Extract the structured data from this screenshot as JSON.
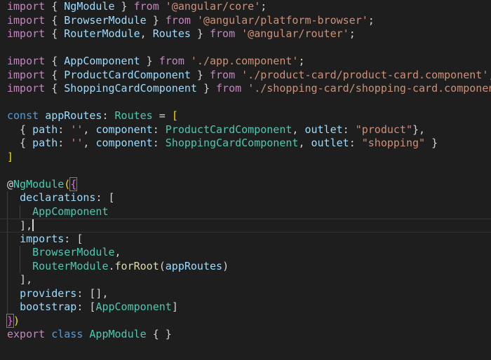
{
  "editor": {
    "lines": [
      [
        {
          "t": "import",
          "c": "keyword"
        },
        {
          "t": " { ",
          "c": "punct"
        },
        {
          "t": "NgModule",
          "c": "variable"
        },
        {
          "t": " } ",
          "c": "punct"
        },
        {
          "t": "from",
          "c": "keyword"
        },
        {
          "t": " ",
          "c": "punct"
        },
        {
          "t": "'@angular/core'",
          "c": "string"
        },
        {
          "t": ";",
          "c": "punct"
        }
      ],
      [
        {
          "t": "import",
          "c": "keyword"
        },
        {
          "t": " { ",
          "c": "punct"
        },
        {
          "t": "BrowserModule",
          "c": "variable"
        },
        {
          "t": " } ",
          "c": "punct"
        },
        {
          "t": "from",
          "c": "keyword"
        },
        {
          "t": " ",
          "c": "punct"
        },
        {
          "t": "'@angular/platform-browser'",
          "c": "string"
        },
        {
          "t": ";",
          "c": "punct"
        }
      ],
      [
        {
          "t": "import",
          "c": "keyword"
        },
        {
          "t": " { ",
          "c": "punct"
        },
        {
          "t": "RouterModule",
          "c": "variable"
        },
        {
          "t": ", ",
          "c": "punct"
        },
        {
          "t": "Routes",
          "c": "variable"
        },
        {
          "t": " } ",
          "c": "punct"
        },
        {
          "t": "from",
          "c": "keyword"
        },
        {
          "t": " ",
          "c": "punct"
        },
        {
          "t": "'@angular/router'",
          "c": "string"
        },
        {
          "t": ";",
          "c": "punct"
        }
      ],
      [],
      [
        {
          "t": "import",
          "c": "keyword"
        },
        {
          "t": " { ",
          "c": "punct"
        },
        {
          "t": "AppComponent",
          "c": "variable"
        },
        {
          "t": " } ",
          "c": "punct"
        },
        {
          "t": "from",
          "c": "keyword"
        },
        {
          "t": " ",
          "c": "punct"
        },
        {
          "t": "'./app.component'",
          "c": "string"
        },
        {
          "t": ";",
          "c": "punct"
        }
      ],
      [
        {
          "t": "import",
          "c": "keyword"
        },
        {
          "t": " { ",
          "c": "punct"
        },
        {
          "t": "ProductCardComponent",
          "c": "variable"
        },
        {
          "t": " } ",
          "c": "punct"
        },
        {
          "t": "from",
          "c": "keyword"
        },
        {
          "t": " ",
          "c": "punct"
        },
        {
          "t": "'./product-card/product-card.component'",
          "c": "string"
        },
        {
          "t": ";",
          "c": "punct"
        }
      ],
      [
        {
          "t": "import",
          "c": "keyword"
        },
        {
          "t": " { ",
          "c": "punct"
        },
        {
          "t": "ShoppingCardComponent",
          "c": "variable"
        },
        {
          "t": " } ",
          "c": "punct"
        },
        {
          "t": "from",
          "c": "keyword"
        },
        {
          "t": " ",
          "c": "punct"
        },
        {
          "t": "'./shopping-card/shopping-card.component'",
          "c": "string"
        },
        {
          "t": ";",
          "c": "punct"
        }
      ],
      [],
      [
        {
          "t": "const",
          "c": "storage"
        },
        {
          "t": " ",
          "c": "punct"
        },
        {
          "t": "appRoutes",
          "c": "variable"
        },
        {
          "t": ": ",
          "c": "punct"
        },
        {
          "t": "Routes",
          "c": "identifier"
        },
        {
          "t": " = ",
          "c": "punct"
        },
        {
          "t": "[",
          "c": "bracket"
        }
      ],
      [
        {
          "t": "  { ",
          "c": "punct"
        },
        {
          "t": "path",
          "c": "property"
        },
        {
          "t": ": ",
          "c": "punct"
        },
        {
          "t": "''",
          "c": "string"
        },
        {
          "t": ", ",
          "c": "punct"
        },
        {
          "t": "component",
          "c": "property"
        },
        {
          "t": ": ",
          "c": "punct"
        },
        {
          "t": "ProductCardComponent",
          "c": "identifier"
        },
        {
          "t": ", ",
          "c": "punct"
        },
        {
          "t": "outlet",
          "c": "property"
        },
        {
          "t": ": ",
          "c": "punct"
        },
        {
          "t": "\"product\"",
          "c": "string"
        },
        {
          "t": "},",
          "c": "punct"
        }
      ],
      [
        {
          "t": "  { ",
          "c": "punct"
        },
        {
          "t": "path",
          "c": "property"
        },
        {
          "t": ": ",
          "c": "punct"
        },
        {
          "t": "''",
          "c": "string"
        },
        {
          "t": ", ",
          "c": "punct"
        },
        {
          "t": "component",
          "c": "property"
        },
        {
          "t": ": ",
          "c": "punct"
        },
        {
          "t": "ShoppingCardComponent",
          "c": "identifier"
        },
        {
          "t": ", ",
          "c": "punct"
        },
        {
          "t": "outlet",
          "c": "property"
        },
        {
          "t": ": ",
          "c": "punct"
        },
        {
          "t": "\"shopping\"",
          "c": "string"
        },
        {
          "t": " }",
          "c": "punct"
        }
      ],
      [
        {
          "t": "]",
          "c": "bracket"
        }
      ],
      [],
      [
        {
          "t": "@",
          "c": "punct"
        },
        {
          "t": "NgModule",
          "c": "identifier"
        },
        {
          "t": "(",
          "c": "bracket"
        },
        {
          "t": "{",
          "c": "paren",
          "box": true
        }
      ],
      [
        {
          "t": "  ",
          "c": "punct"
        },
        {
          "t": "declarations",
          "c": "property"
        },
        {
          "t": ": ",
          "c": "punct"
        },
        {
          "t": "[",
          "c": "plain"
        }
      ],
      [
        {
          "t": "    ",
          "c": "punct"
        },
        {
          "t": "AppComponent",
          "c": "identifier"
        }
      ],
      [
        {
          "t": "  ],",
          "c": "punct"
        },
        {
          "t": "",
          "c": "punct",
          "cursor": true
        }
      ],
      [
        {
          "t": "  ",
          "c": "punct"
        },
        {
          "t": "imports",
          "c": "property"
        },
        {
          "t": ": ",
          "c": "punct"
        },
        {
          "t": "[",
          "c": "plain"
        }
      ],
      [
        {
          "t": "    ",
          "c": "punct"
        },
        {
          "t": "BrowserModule",
          "c": "identifier"
        },
        {
          "t": ",",
          "c": "punct"
        }
      ],
      [
        {
          "t": "    ",
          "c": "punct"
        },
        {
          "t": "RouterModule",
          "c": "identifier"
        },
        {
          "t": ".",
          "c": "punct"
        },
        {
          "t": "forRoot",
          "c": "function"
        },
        {
          "t": "(",
          "c": "plain"
        },
        {
          "t": "appRoutes",
          "c": "variable"
        },
        {
          "t": ")",
          "c": "plain"
        }
      ],
      [
        {
          "t": "  ],",
          "c": "punct"
        }
      ],
      [
        {
          "t": "  ",
          "c": "punct"
        },
        {
          "t": "providers",
          "c": "property"
        },
        {
          "t": ": [],",
          "c": "punct"
        }
      ],
      [
        {
          "t": "  ",
          "c": "punct"
        },
        {
          "t": "bootstrap",
          "c": "property"
        },
        {
          "t": ": [",
          "c": "punct"
        },
        {
          "t": "AppComponent",
          "c": "identifier"
        },
        {
          "t": "]",
          "c": "punct"
        }
      ],
      [
        {
          "t": "}",
          "c": "paren",
          "box": true
        },
        {
          "t": ")",
          "c": "bracket"
        }
      ],
      [
        {
          "t": "export",
          "c": "keyword"
        },
        {
          "t": " ",
          "c": "punct"
        },
        {
          "t": "class",
          "c": "storage"
        },
        {
          "t": " ",
          "c": "punct"
        },
        {
          "t": "AppModule",
          "c": "identifier"
        },
        {
          "t": " { }",
          "c": "punct"
        }
      ]
    ],
    "current_line": 17,
    "guides": [
      {
        "from": 15,
        "to": 23,
        "indent": 1
      },
      {
        "from": 16,
        "to": 16,
        "indent": 2
      },
      {
        "from": 19,
        "to": 20,
        "indent": 2
      }
    ],
    "colors": {
      "background": "#1e1e1e",
      "keyword": "#c586c0",
      "storage": "#569cd6",
      "identifier": "#4ec9b0",
      "variable": "#9cdcfe",
      "string": "#ce9178",
      "function": "#dcdcaa",
      "bracket": "#ffd700",
      "paren": "#da70d6"
    }
  }
}
